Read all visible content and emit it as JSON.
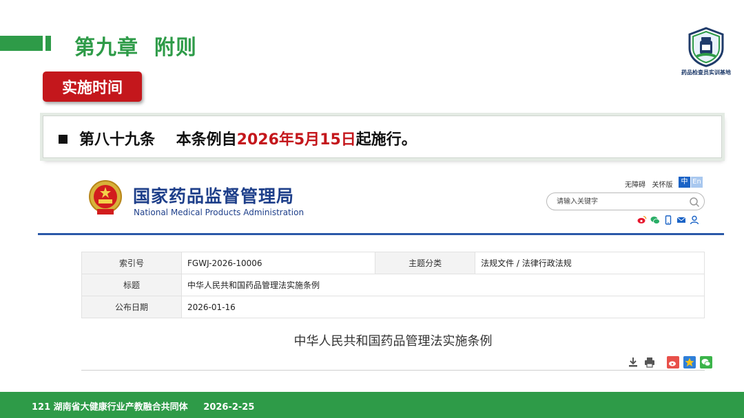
{
  "chapter": {
    "title": "第九章  附则"
  },
  "logo": {
    "caption": "药品检查员实训基地"
  },
  "section": {
    "tag": "实施时间"
  },
  "article": {
    "prefix": "第八十九条    本条例自",
    "highlight": "2026年5月15日",
    "suffix": "起施行。"
  },
  "site": {
    "name_cn": "国家药品监督管理局",
    "name_en": "National Medical Products Administration",
    "util_links": "无障碍   关怀版",
    "lang_zh": "中",
    "lang_en": "En",
    "search_placeholder": "请输入关键字",
    "social_icons": [
      "weibo-icon",
      "wechat-icon",
      "mobile-icon",
      "mail-icon",
      "user-icon"
    ]
  },
  "table": {
    "row1": {
      "k1": "索引号",
      "v1": "FGWJ-2026-10006",
      "k2": "主题分类",
      "v2": "法规文件 / 法律行政法规"
    },
    "row2": {
      "k": "标题",
      "v": "中华人民共和国药品管理法实施条例"
    },
    "row3": {
      "k": "公布日期",
      "v": "2026-01-16"
    }
  },
  "doc": {
    "title": "中华人民共和国药品管理法实施条例",
    "tools": [
      "download-icon",
      "print-icon",
      "share-weibo-icon",
      "share-qzone-icon",
      "share-wechat-icon"
    ]
  },
  "footer": {
    "text": "121 湖南省大健康行业产教融合共同体     2026-2-25"
  },
  "colors": {
    "green": "#2e9b48",
    "red": "#c4171c",
    "navy": "#1e3f8a"
  }
}
